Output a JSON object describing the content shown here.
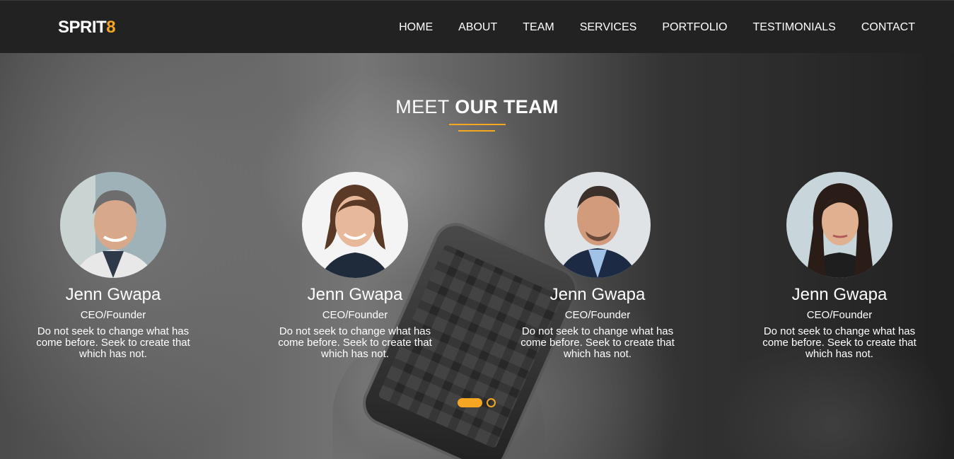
{
  "brand": {
    "name": "SPRIT",
    "accent": "8",
    "accent_color": "#f5a623"
  },
  "nav": {
    "items": [
      "HOME",
      "ABOUT",
      "TEAM",
      "SERVICES",
      "PORTFOLIO",
      "TESTIMONIALS",
      "CONTACT"
    ]
  },
  "section": {
    "title_light": "MEET",
    "title_bold": "OUR TEAM"
  },
  "team": [
    {
      "name": "Jenn Gwapa",
      "role": "CEO/Founder",
      "quote": "Do not seek to change what has come before. Seek to create that which has not.",
      "avatar": "man-smiling-avatar"
    },
    {
      "name": "Jenn Gwapa",
      "role": "CEO/Founder",
      "quote": "Do not seek to change what has come before. Seek to create that which has not.",
      "avatar": "woman-smiling-avatar"
    },
    {
      "name": "Jenn Gwapa",
      "role": "CEO/Founder",
      "quote": "Do not seek to change what has come before. Seek to create that which has not.",
      "avatar": "man-suit-avatar"
    },
    {
      "name": "Jenn Gwapa",
      "role": "CEO/Founder",
      "quote": "Do not seek to change what has come before. Seek to create that which has not.",
      "avatar": "woman-dark-hair-avatar"
    }
  ],
  "carousel": {
    "pages": 2,
    "active": 1
  }
}
